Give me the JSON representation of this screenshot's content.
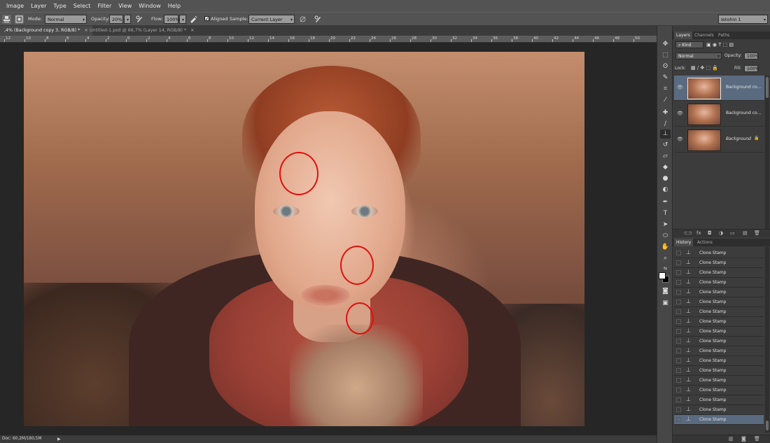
{
  "menu": [
    "Image",
    "Layer",
    "Type",
    "Select",
    "Filter",
    "View",
    "Window",
    "Help"
  ],
  "options": {
    "mode_label": "Mode:",
    "mode_value": "Normal",
    "opacity_label": "Opacity:",
    "opacity_value": "20%",
    "flow_label": "Flow:",
    "flow_value": "100%",
    "aligned_label": "Aligned",
    "sample_label": "Sample:",
    "sample_value": "Current Layer",
    "workspace_value": "Ietohin 1"
  },
  "tabs": [
    {
      "label": ",4% (Background copy 3, RGB/8) *",
      "active": true
    },
    {
      "label": "Untitled-1.psd @ 66,7% (Layer 14, RGB/8) *",
      "active": false
    }
  ],
  "ruler": [
    "12",
    "10",
    "8",
    "6",
    "4",
    "2",
    "0",
    "2",
    "4",
    "6",
    "8",
    "10",
    "12",
    "14",
    "16",
    "18",
    "20",
    "22",
    "24",
    "26",
    "28",
    "30",
    "32",
    "34",
    "36",
    "38",
    "40",
    "42",
    "44",
    "46",
    "48",
    "50"
  ],
  "status": {
    "doc": "Doc: 60,2M/180,5M"
  },
  "layers_panel": {
    "tabs": [
      "Layers",
      "Channels",
      "Paths"
    ],
    "kind_label": "Kind",
    "blend_mode": "Normal",
    "opacity_label": "Opacity:",
    "opacity_value": "100%",
    "lock_label": "Lock:",
    "fill_label": "Fill:",
    "fill_value": "100%",
    "layers": [
      {
        "name": "Background co...",
        "selected": true,
        "italic": false
      },
      {
        "name": "Background co...",
        "selected": false,
        "italic": false
      },
      {
        "name": "Background",
        "selected": false,
        "italic": true
      }
    ]
  },
  "history_panel": {
    "tabs": [
      "History",
      "Actions"
    ],
    "items": [
      "Clone Stamp",
      "Clone Stamp",
      "Clone Stamp",
      "Clone Stamp",
      "Clone Stamp",
      "Clone Stamp",
      "Clone Stamp",
      "Clone Stamp",
      "Clone Stamp",
      "Clone Stamp",
      "Clone Stamp",
      "Clone Stamp",
      "Clone Stamp",
      "Clone Stamp",
      "Clone Stamp",
      "Clone Stamp",
      "Clone Stamp",
      "Clone Stamp"
    ]
  },
  "colors": {
    "annotation": "#e01010",
    "selection": "#5a6b80",
    "ui_panel": "#3c3c3c",
    "menu_bar": "#535353"
  }
}
